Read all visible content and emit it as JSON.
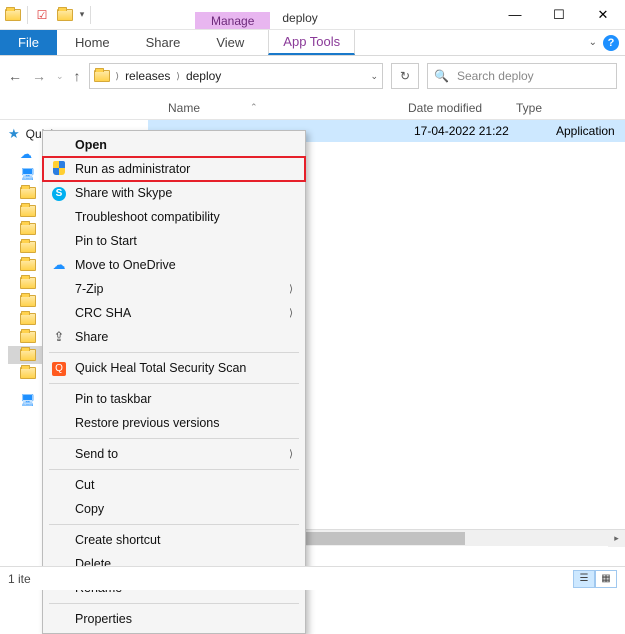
{
  "window": {
    "manage_tab": "Manage",
    "title": "deploy"
  },
  "ribbon": {
    "file": "File",
    "home": "Home",
    "share": "Share",
    "view": "View",
    "app_tools": "App Tools"
  },
  "address": {
    "crumb1": "releases",
    "crumb2": "deploy"
  },
  "search": {
    "placeholder": "Search deploy"
  },
  "columns": {
    "name": "Name",
    "date": "Date modified",
    "type": "Type"
  },
  "nav": {
    "quick_access": "Quick access"
  },
  "file_row": {
    "date": "17-04-2022 21:22",
    "type": "Application"
  },
  "status": {
    "count": "1 ite"
  },
  "context_menu": {
    "open": "Open",
    "run_as_admin": "Run as administrator",
    "share_skype": "Share with Skype",
    "troubleshoot": "Troubleshoot compatibility",
    "pin_start": "Pin to Start",
    "onedrive": "Move to OneDrive",
    "seven_zip": "7-Zip",
    "crc_sha": "CRC SHA",
    "share": "Share",
    "quick_heal": "Quick Heal Total Security Scan",
    "pin_taskbar": "Pin to taskbar",
    "restore": "Restore previous versions",
    "send_to": "Send to",
    "cut": "Cut",
    "copy": "Copy",
    "create_shortcut": "Create shortcut",
    "delete": "Delete",
    "rename": "Rename",
    "properties": "Properties"
  }
}
